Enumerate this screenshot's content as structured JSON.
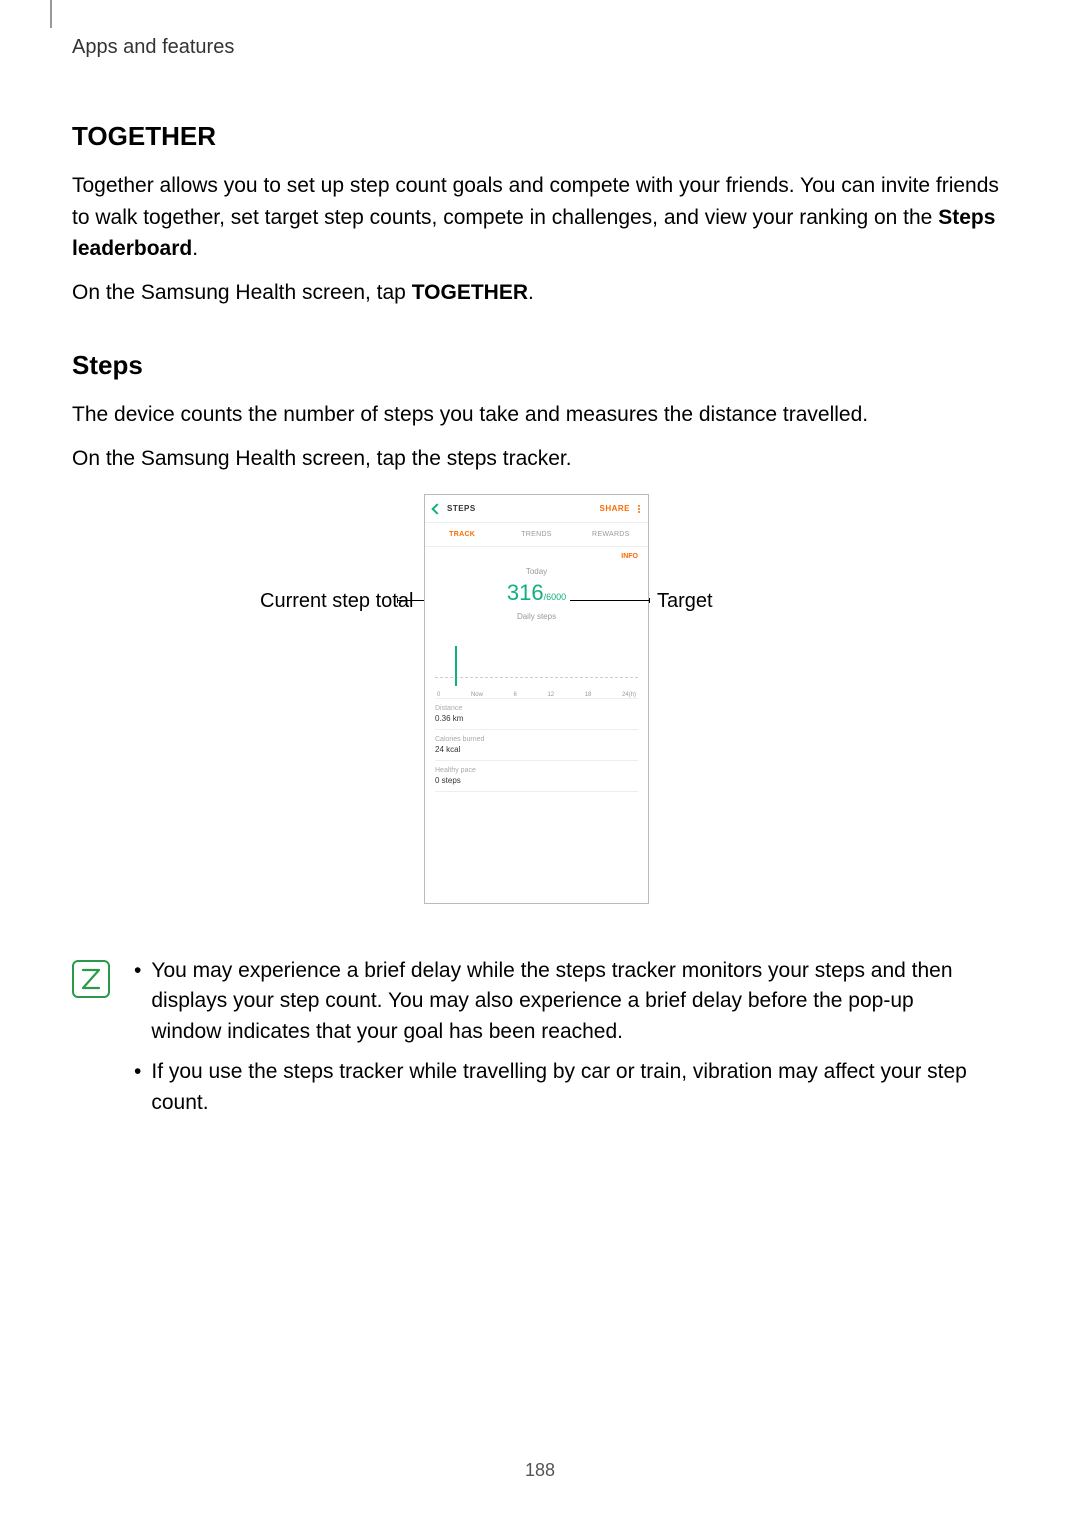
{
  "header": {
    "breadcrumb": "Apps and features"
  },
  "together": {
    "title": "TOGETHER",
    "para_pre": "Together allows you to set up step count goals and compete with your friends. You can invite friends to walk together, set target step counts, compete in challenges, and view your ranking on the ",
    "para_bold": "Steps leaderboard",
    "para_post": ".",
    "instr_pre": "On the Samsung Health screen, tap ",
    "instr_bold": "TOGETHER",
    "instr_post": "."
  },
  "steps": {
    "title": "Steps",
    "para1": "The device counts the number of steps you take and measures the distance travelled.",
    "para2": "On the Samsung Health screen, tap the steps tracker."
  },
  "callouts": {
    "left": "Current step total",
    "right": "Target"
  },
  "phone": {
    "title": "STEPS",
    "share": "SHARE",
    "tabs": {
      "track": "TRACK",
      "trends": "TRENDS",
      "rewards": "REWARDS"
    },
    "info": "INFO",
    "today": "Today",
    "step_count": "316",
    "step_goal": "/6000",
    "daily": "Daily steps",
    "xaxis": {
      "a": "0",
      "b": "Now",
      "c": "6",
      "d": "12",
      "e": "18",
      "f": "24(h)"
    },
    "distance_lbl": "Distance",
    "distance_val": "0.36 km",
    "calories_lbl": "Calories burned",
    "calories_val": "24 kcal",
    "pace_lbl": "Healthy pace",
    "pace_val": "0 steps"
  },
  "notes": {
    "item1": "You may experience a brief delay while the steps tracker monitors your steps and then displays your step count. You may also experience a brief delay before the pop-up window indicates that your goal has been reached.",
    "item2": "If you use the steps tracker while travelling by car or train, vibration may affect your step count."
  },
  "chart_data": {
    "type": "bar",
    "title": "Daily steps",
    "categories": [
      "0",
      "Now",
      "6",
      "12",
      "18",
      "24(h)"
    ],
    "values_note": "Only a single bar near 'Now' is visible; precise hourly values are not labeled.",
    "current_total": 316,
    "goal": 6000,
    "xlabel": "",
    "ylabel": ""
  },
  "page_number": "188"
}
